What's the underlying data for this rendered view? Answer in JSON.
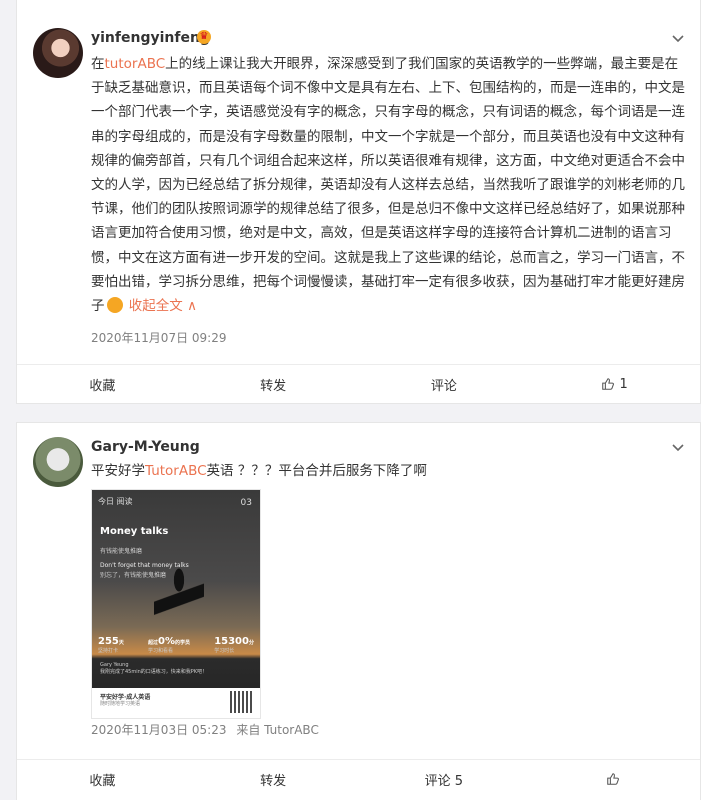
{
  "posts": [
    {
      "username": "yinfengyinfeng",
      "text_prefix_link": "tutorABC",
      "text": "上的线上课让我大开眼界，深深感受到了我们国家的英语教学的一些弊端，最主要是在于缺乏基础意识，而且英语每个词不像中文是具有左右、上下、包围结构的，而是一连串的，中文是一个部门代表一个字，英语感觉没有字的概念，只有字母的概念，只有词语的概念，每个词语是一连串的字母组成的，而是没有字母数量的限制，中文一个字就是一个部分，而且英语也没有中文这种有规律的偏旁部首，只有几个词组合起来这样，所以英语很难有规律，这方面，中文绝对更适合不会中文的人学，因为已经总结了拆分规律，英语却没有人这样去总结，当然我听了跟谁学的刘彬老师的几节课，他们的团队按照词源学的规律总结了很多，但是总归不像中文这样已经总结好了，如果说那种语言更加符合使用习惯，绝对是中文，高效，但是英语这样字母的连接符合计算机二进制的语言习惯，中文在这方面有进一步开发的空间。这就是我上了这些课的结论，总而言之，学习一门语言，不要怕出错，学习拆分思维，把每个词慢慢读，基础打牢一定有很多收获，因为基础打牢才能更好建房子",
      "collapse_label": "收起全文",
      "date": "2020年11月07日 09:29",
      "actions": {
        "favorite": "收藏",
        "repost": "转发",
        "comment": "评论",
        "like_count": "1"
      }
    },
    {
      "username": "Gary-M-Yeung",
      "text_before": "平安好学",
      "text_link": "TutorABC",
      "text_after": "英语 ？？？平台合并后服务下降了啊",
      "image": {
        "top_left": "今日 阅读",
        "page_num": "03",
        "title": "Money talks",
        "subtitle": "有钱能使鬼推磨",
        "quote": "Don't forget that money talks",
        "quote_cn": "别忘了，有钱能使鬼推磨",
        "stat1_value": "255",
        "stat1_unit": "天",
        "stat1_label": "坚持打卡",
        "stat2_prefix": "超过",
        "stat2_value": "0%",
        "stat2_suffix": "的学员",
        "stat2_label": "学习和看看",
        "stat3_value": "15300",
        "stat3_unit": "分",
        "stat3_label": "学习时长",
        "user_line1": "Gary Yeung",
        "user_line2": "我刚完成了45min的口语练习，快来和我PK吧！",
        "footer_title": "平安好学·成人英语",
        "footer_sub": "随时随地学习英语"
      },
      "date": "2020年11月03日 05:23",
      "source": "来自 TutorABC",
      "actions": {
        "favorite": "收藏",
        "repost": "转发",
        "comment": "评论 5",
        "like_count": ""
      }
    }
  ],
  "colors": {
    "link": "#eb7350",
    "page_bg": "#f2f2f5",
    "meta": "#808080"
  },
  "icons": {
    "menu": "chevron-down-icon",
    "like": "thumbs-up-icon",
    "vip": "crown-badge-icon",
    "emoji": "pouting-face-emoji"
  }
}
